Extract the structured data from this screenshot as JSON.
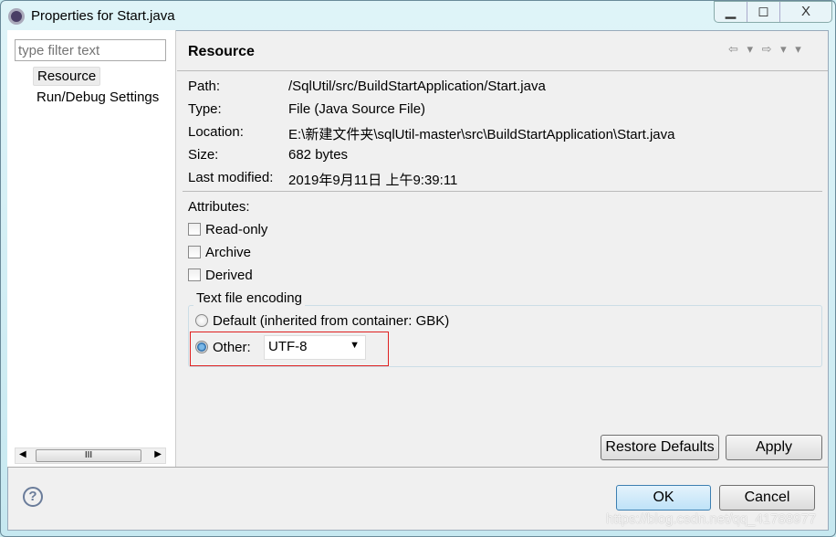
{
  "window": {
    "title": "Properties for Start.java",
    "minimize": "▁",
    "maximize": "◻",
    "close": "X"
  },
  "sidebar": {
    "filter_placeholder": "type filter text",
    "items": [
      {
        "label": "Resource"
      },
      {
        "label": "Run/Debug Settings"
      }
    ],
    "scroll_thumb": "III"
  },
  "header": {
    "title": "Resource",
    "nav": "⇦ ▾ ⇨ ▾ ▾"
  },
  "info": [
    {
      "label": "Path:",
      "value": "/SqlUtil/src/BuildStartApplication/Start.java"
    },
    {
      "label": "Type:",
      "value": "File  (Java Source File)"
    },
    {
      "label": "Location:",
      "value": "E:\\新建文件夹\\sqlUtil-master\\src\\BuildStartApplication\\Start.java"
    },
    {
      "label": "Size:",
      "value": "682  bytes"
    },
    {
      "label": "Last modified:",
      "value": "2019年9月11日 上午9:39:11"
    }
  ],
  "attributes": {
    "label": "Attributes:",
    "items": [
      {
        "label": "Read-only",
        "checked": false
      },
      {
        "label": "Archive",
        "checked": false
      },
      {
        "label": "Derived",
        "checked": false
      }
    ]
  },
  "encoding": {
    "label": "Text file encoding",
    "default_label": "Default (inherited from container: GBK)",
    "other_label": "Other:",
    "selected": "other",
    "value": "UTF-8"
  },
  "buttons": {
    "restore": "Restore Defaults",
    "apply": "Apply",
    "ok": "OK",
    "cancel": "Cancel",
    "help": "?"
  },
  "watermark": "https://blog.csdn.net/qq_41788977",
  "colors": {
    "highlight": "#e02020",
    "ok_button": "#bfe2f8"
  }
}
